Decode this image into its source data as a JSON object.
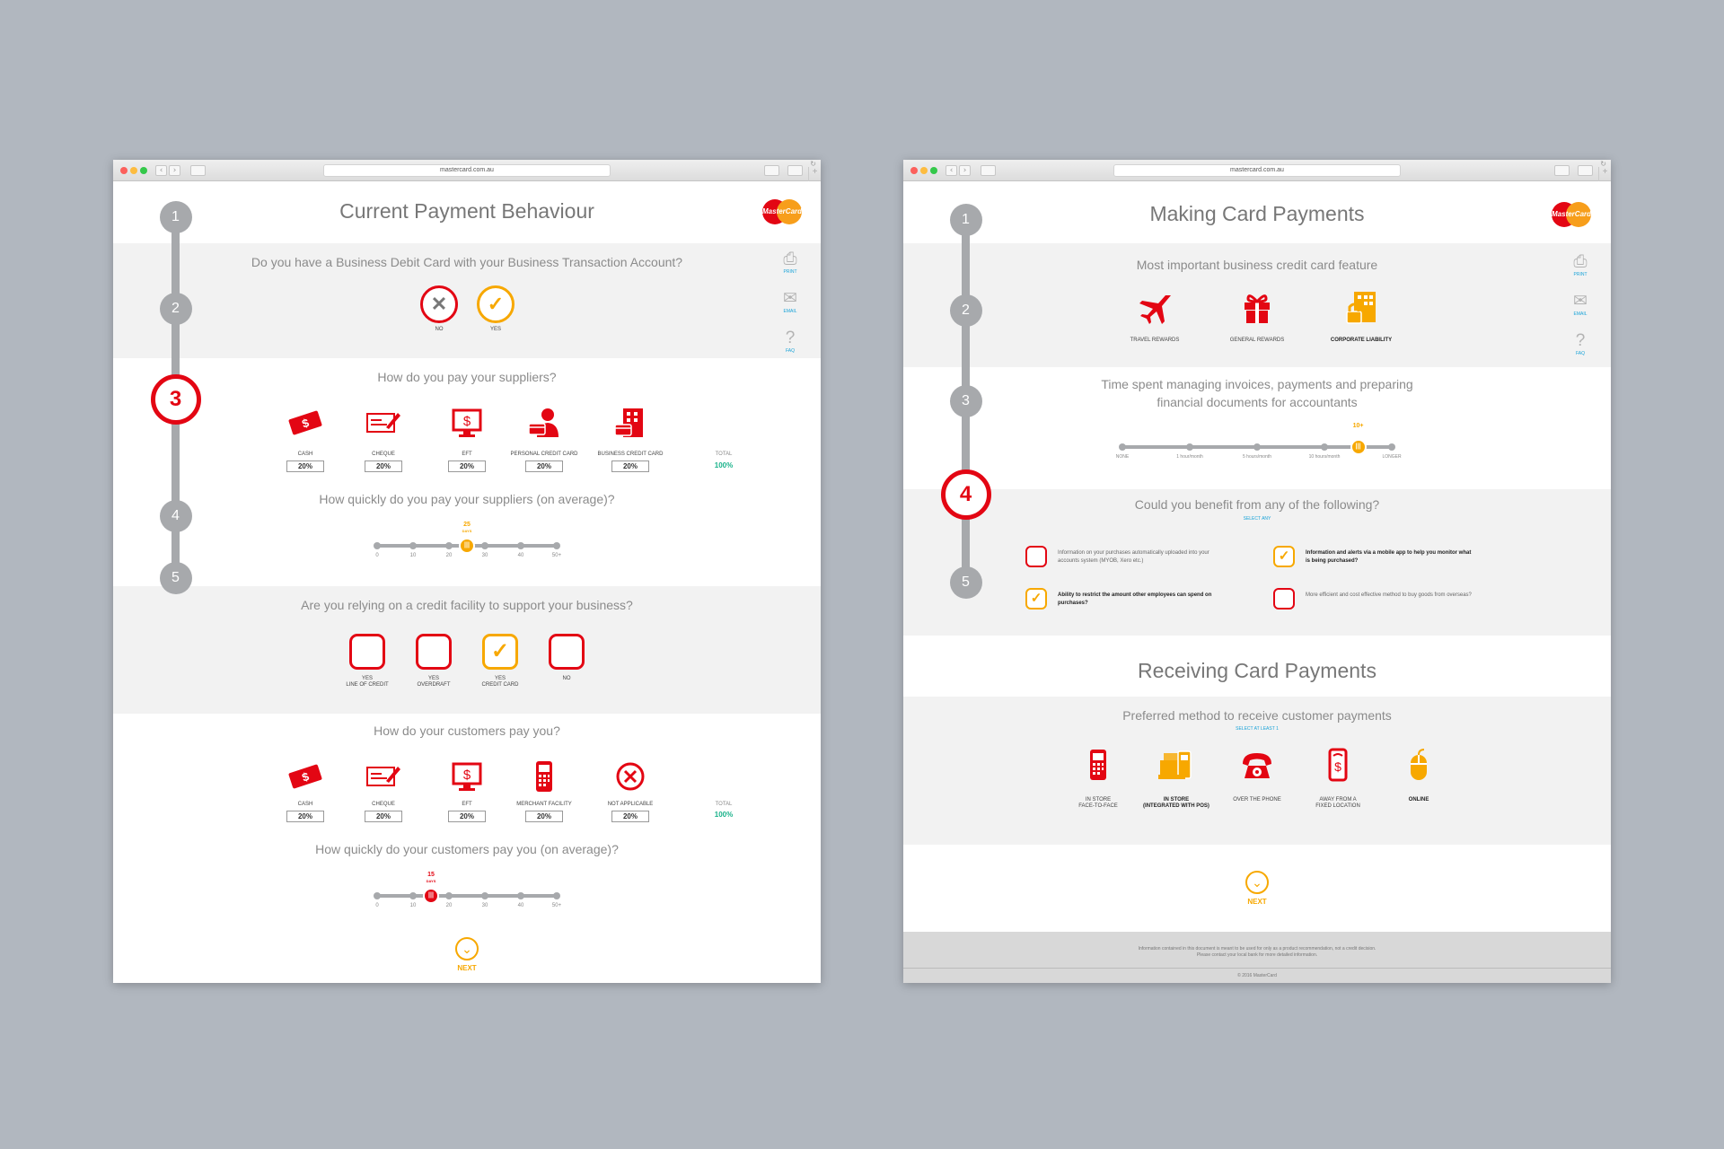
{
  "left": {
    "url": "mastercard.com.au",
    "title": "Current Payment Behaviour",
    "logo": "MasterCard",
    "side_tools": [
      {
        "label": "PRINT",
        "icon": "print-icon"
      },
      {
        "label": "EMAIL",
        "icon": "email-icon"
      },
      {
        "label": "FAQ",
        "icon": "faq-icon"
      }
    ],
    "steps": [
      "1",
      "2",
      "3",
      "4",
      "5"
    ],
    "active_step": "3",
    "q1": "Do you have a Business Debit Card with your Business Transaction Account?",
    "q1_options": [
      {
        "label": "NO",
        "icon": "cross-icon",
        "selected": false
      },
      {
        "label": "YES",
        "icon": "check-icon",
        "selected": true
      }
    ],
    "q2": "How do you pay your suppliers?",
    "q2_items": [
      {
        "label": "CASH",
        "value": "20%",
        "icon": "cash-icon"
      },
      {
        "label": "CHEQUE",
        "value": "20%",
        "icon": "cheque-icon"
      },
      {
        "label": "EFT",
        "value": "20%",
        "icon": "eft-icon"
      },
      {
        "label": "PERSONAL CREDIT CARD",
        "value": "20%",
        "icon": "personal-card-icon"
      },
      {
        "label": "BUSINESS CREDIT CARD",
        "value": "20%",
        "icon": "business-card-icon"
      }
    ],
    "q2_total_label": "TOTAL",
    "q2_total": "100%",
    "q3": "How quickly do you pay your suppliers (on average)?",
    "q3_ticks": [
      "0",
      "10",
      "20",
      "30",
      "40",
      "50+"
    ],
    "q3_value": "25",
    "q3_unit": "DAYS",
    "q3_knob_color": "#f7a800",
    "q4": "Are you relying on a credit facility to support your business?",
    "q4_options": [
      {
        "l1": "YES",
        "l2": "LINE OF CREDIT",
        "selected": false
      },
      {
        "l1": "YES",
        "l2": "OVERDRAFT",
        "selected": false
      },
      {
        "l1": "YES",
        "l2": "CREDIT CARD",
        "selected": true
      },
      {
        "l1": "NO",
        "l2": "",
        "selected": false
      }
    ],
    "q5": "How do your customers pay you?",
    "q5_items": [
      {
        "label": "CASH",
        "value": "20%",
        "icon": "cash-icon"
      },
      {
        "label": "CHEQUE",
        "value": "20%",
        "icon": "cheque-icon"
      },
      {
        "label": "EFT",
        "value": "20%",
        "icon": "eft-icon"
      },
      {
        "label": "MERCHANT FACILITY",
        "value": "20%",
        "icon": "terminal-icon"
      },
      {
        "label": "NOT APPLICABLE",
        "value": "20%",
        "icon": "cross-icon"
      }
    ],
    "q5_total_label": "TOTAL",
    "q5_total": "100%",
    "q6": "How quickly do your customers pay you (on average)?",
    "q6_ticks": [
      "0",
      "10",
      "20",
      "30",
      "40",
      "50+"
    ],
    "q6_value": "15",
    "q6_unit": "DAYS",
    "q6_knob_color": "#e30613",
    "next": "NEXT"
  },
  "right": {
    "url": "mastercard.com.au",
    "title": "Making Card Payments",
    "logo": "MasterCard",
    "side_tools": [
      {
        "label": "PRINT",
        "icon": "print-icon"
      },
      {
        "label": "EMAIL",
        "icon": "email-icon"
      },
      {
        "label": "FAQ",
        "icon": "faq-icon"
      }
    ],
    "steps": [
      "1",
      "2",
      "3",
      "4",
      "5"
    ],
    "active_step": "4",
    "q1": "Most important business credit card feature",
    "q1_items": [
      {
        "label": "TRAVEL REWARDS",
        "icon": "plane-icon",
        "selected": false
      },
      {
        "label": "GENERAL REWARDS",
        "icon": "gift-icon",
        "selected": false
      },
      {
        "label": "CORPORATE LIABILITY",
        "icon": "building-lock-icon",
        "selected": true
      }
    ],
    "q2": "Time spent managing invoices, payments and preparing financial documents for accountants",
    "q2_ticks": [
      "NONE",
      "1 hour/month",
      "5 hours/month",
      "10 hours/month",
      "LONGER"
    ],
    "q2_value": "10+",
    "q3": "Could you benefit from any of the following?",
    "q3_sub": "SELECT ANY",
    "q3_options": [
      {
        "text": "Information on your purchases automatically uploaded into your accounts system (MYOB, Xero etc.)",
        "selected": false
      },
      {
        "text": "Information and alerts via a mobile app to help you monitor what is being purchased?",
        "selected": true
      },
      {
        "text": "Ability to restrict the amount other employees can spend on purchases?",
        "selected": true
      },
      {
        "text": "More efficient and cost effective method to buy goods from overseas?",
        "selected": false
      }
    ],
    "section2": "Receiving Card Payments",
    "q4": "Preferred method to receive customer payments",
    "q4_sub": "SELECT AT LEAST 1",
    "q4_items": [
      {
        "l1": "IN STORE",
        "l2": "FACE-TO-FACE",
        "icon": "terminal-icon",
        "selected": false
      },
      {
        "l1": "IN STORE",
        "l2": "(INTEGRATED WITH POS)",
        "icon": "pos-icon",
        "selected": true
      },
      {
        "l1": "OVER THE PHONE",
        "l2": "",
        "icon": "phone-icon",
        "selected": false
      },
      {
        "l1": "AWAY FROM A",
        "l2": "FIXED LOCATION",
        "icon": "mobile-pay-icon",
        "selected": false
      },
      {
        "l1": "ONLINE",
        "l2": "",
        "icon": "mouse-icon",
        "selected": true
      }
    ],
    "next": "NEXT",
    "footer1": "Information contained in this document is meant to be used for only as a product recommendation, not a credit decision.",
    "footer2": "Please contact your local bank for more detailed information.",
    "copyright": "© 2016 MasterCard"
  }
}
